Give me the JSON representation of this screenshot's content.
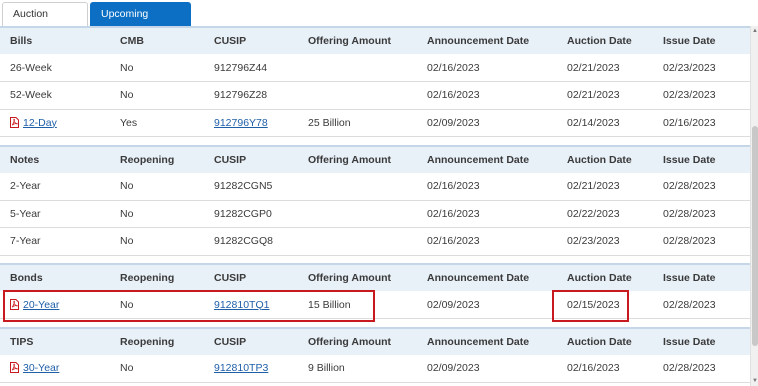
{
  "tabs": {
    "results": "Auction Results",
    "upcoming": "Upcoming Auctions"
  },
  "bills": {
    "headers": [
      "Bills",
      "CMB",
      "CUSIP",
      "Offering Amount",
      "Announcement Date",
      "Auction Date",
      "Issue Date"
    ],
    "rows": [
      {
        "term": "26-Week",
        "flag": "No",
        "cusip": "912796Z44",
        "amount": "",
        "announce": "02/16/2023",
        "auction": "02/21/2023",
        "issue": "02/23/2023",
        "pdf": false
      },
      {
        "term": "52-Week",
        "flag": "No",
        "cusip": "912796Z28",
        "amount": "",
        "announce": "02/16/2023",
        "auction": "02/21/2023",
        "issue": "02/23/2023",
        "pdf": false
      },
      {
        "term": "12-Day",
        "flag": "Yes",
        "cusip": "912796Y78",
        "amount": "25 Billion",
        "announce": "02/09/2023",
        "auction": "02/14/2023",
        "issue": "02/16/2023",
        "pdf": true
      }
    ]
  },
  "notes": {
    "headers": [
      "Notes",
      "Reopening",
      "CUSIP",
      "Offering Amount",
      "Announcement Date",
      "Auction Date",
      "Issue Date"
    ],
    "rows": [
      {
        "term": "2-Year",
        "flag": "No",
        "cusip": "91282CGN5",
        "amount": "",
        "announce": "02/16/2023",
        "auction": "02/21/2023",
        "issue": "02/28/2023",
        "pdf": false
      },
      {
        "term": "5-Year",
        "flag": "No",
        "cusip": "91282CGP0",
        "amount": "",
        "announce": "02/16/2023",
        "auction": "02/22/2023",
        "issue": "02/28/2023",
        "pdf": false
      },
      {
        "term": "7-Year",
        "flag": "No",
        "cusip": "91282CGQ8",
        "amount": "",
        "announce": "02/16/2023",
        "auction": "02/23/2023",
        "issue": "02/28/2023",
        "pdf": false
      }
    ]
  },
  "bonds": {
    "headers": [
      "Bonds",
      "Reopening",
      "CUSIP",
      "Offering Amount",
      "Announcement Date",
      "Auction Date",
      "Issue Date"
    ],
    "rows": [
      {
        "term": "20-Year",
        "flag": "No",
        "cusip": "912810TQ1",
        "amount": "15 Billion",
        "announce": "02/09/2023",
        "auction": "02/15/2023",
        "issue": "02/28/2023",
        "pdf": true
      }
    ]
  },
  "tips": {
    "headers": [
      "TIPS",
      "Reopening",
      "CUSIP",
      "Offering Amount",
      "Announcement Date",
      "Auction Date",
      "Issue Date"
    ],
    "rows": [
      {
        "term": "30-Year",
        "flag": "No",
        "cusip": "912810TP3",
        "amount": "9 Billion",
        "announce": "02/09/2023",
        "auction": "02/16/2023",
        "issue": "02/28/2023",
        "pdf": true
      }
    ]
  },
  "colors": {
    "tab_active": "#0c6fc4",
    "header_bg": "#e8f0f8",
    "link": "#1f5fa8",
    "highlight": "#c8191e"
  }
}
